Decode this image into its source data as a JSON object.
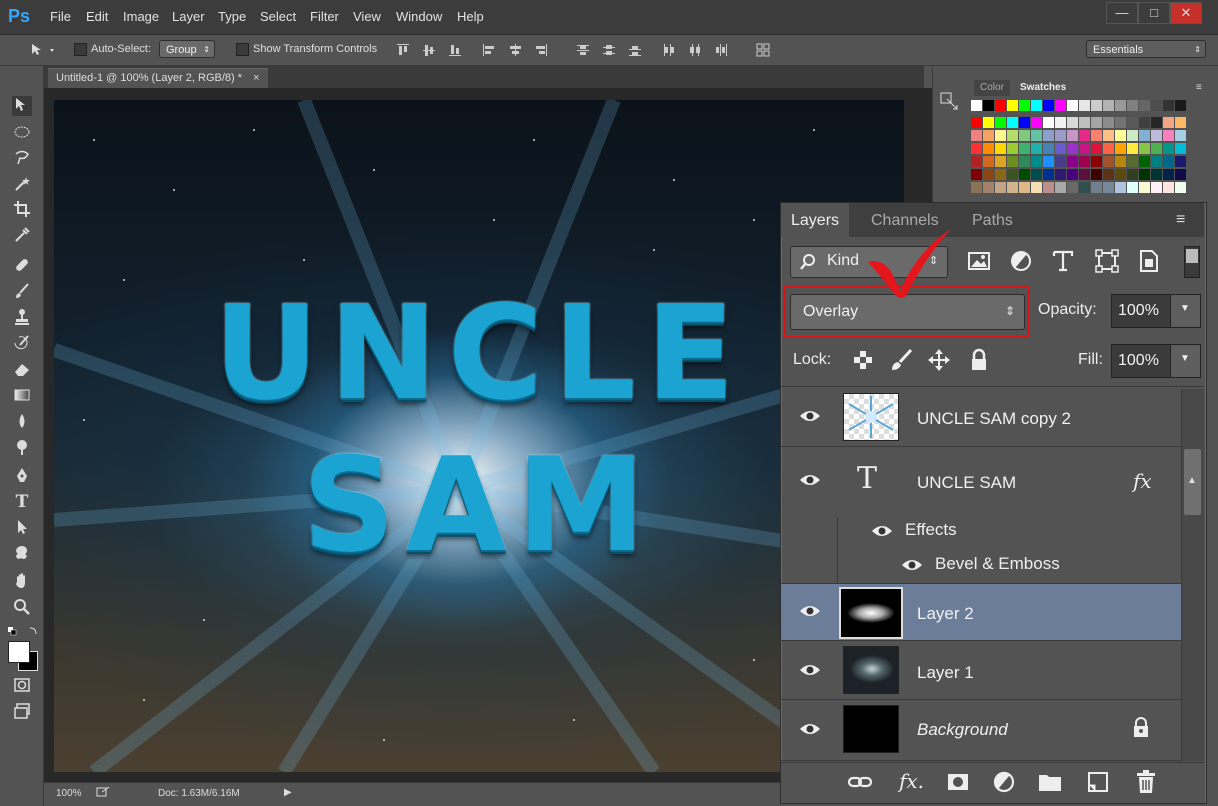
{
  "app": {
    "logo": "Ps",
    "menu": [
      "File",
      "Edit",
      "Image",
      "Layer",
      "Type",
      "Select",
      "Filter",
      "View",
      "Window",
      "Help"
    ]
  },
  "window_buttons": [
    "—",
    "□",
    "✕"
  ],
  "options_bar": {
    "auto_select_label": "Auto-Select:",
    "auto_select_value": "Group",
    "show_transform_label": "Show Transform Controls",
    "workspace": "Essentials"
  },
  "document": {
    "tab_title": "Untitled-1 @ 100% (Layer 2, RGB/8) *",
    "zoom": "100%",
    "doc_size": "Doc: 1.63M/6.16M"
  },
  "artwork": {
    "line1": "UNCLE",
    "line2": "SAM"
  },
  "swatches_panel": {
    "tabs": [
      "Color",
      "Swatches"
    ],
    "active_tab": "Swatches",
    "rows": [
      [
        "#ffffff",
        "#000000",
        "#ff0000",
        "#ffff00",
        "#00ff00",
        "#00ffff",
        "#0000ff",
        "#ff00ff",
        "#ffffff",
        "#e6e6e6",
        "#cccccc",
        "#b3b3b3",
        "#999999",
        "#808080",
        "#666666",
        "#4d4d4d",
        "#333333",
        "#1a1a1a"
      ],
      [
        "#ff0000",
        "#ffff00",
        "#00ff00",
        "#00ffff",
        "#0000ff",
        "#ff00ff",
        "#ffffff",
        "#f2f2f2",
        "#d9d9d9",
        "#bfbfbf",
        "#a6a6a6",
        "#8c8c8c",
        "#737373",
        "#595959",
        "#404040",
        "#262626",
        "#f4a582",
        "#fdb863"
      ],
      [
        "#f08080",
        "#f4a460",
        "#fff68f",
        "#b3de69",
        "#7fc97f",
        "#66c2a5",
        "#8da0cb",
        "#9e9ac8",
        "#c994c7",
        "#e7298a",
        "#fb8072",
        "#fdc086",
        "#ffff99",
        "#ccebc5",
        "#80b1d3",
        "#bebada",
        "#f781bf",
        "#a6cee3"
      ],
      [
        "#ff3030",
        "#ff8c00",
        "#ffd700",
        "#9acd32",
        "#3cb371",
        "#20b2aa",
        "#4682b4",
        "#6a5acd",
        "#9932cc",
        "#c71585",
        "#dc143c",
        "#ff6347",
        "#ffa500",
        "#ffeb3b",
        "#8bc34a",
        "#4caf50",
        "#009688",
        "#00bcd4"
      ],
      [
        "#b22222",
        "#d2691e",
        "#daa520",
        "#6b8e23",
        "#2e8b57",
        "#008b8b",
        "#1e90ff",
        "#483d8b",
        "#8b008b",
        "#a0004f",
        "#8b0000",
        "#a0522d",
        "#b8860b",
        "#556b2f",
        "#006400",
        "#008080",
        "#00688b",
        "#191970"
      ],
      [
        "#7f0000",
        "#8b4513",
        "#8b6914",
        "#3b5323",
        "#004d00",
        "#004d4d",
        "#00308f",
        "#2e1a6e",
        "#4b0082",
        "#5b0f3a",
        "#3f0000",
        "#5c3317",
        "#5c4a0d",
        "#2f3f1f",
        "#003300",
        "#003333",
        "#002447",
        "#120a4a"
      ],
      [
        "#8b7355",
        "#a0826d",
        "#c4a484",
        "#d2b48c",
        "#deb887",
        "#f5deb3",
        "#bc8f8f",
        "#a9a9a9",
        "#696969",
        "#2f4f4f",
        "#708090",
        "#778899",
        "#b0c4de",
        "#e0ffff",
        "#fafad2",
        "#fff0f5",
        "#ffe4e1",
        "#f0fff0"
      ]
    ]
  },
  "layers_panel": {
    "tabs": [
      "Layers",
      "Channels",
      "Paths"
    ],
    "kind_label": "Kind",
    "blend_mode": "Overlay",
    "opacity_label": "Opacity:",
    "opacity_value": "100%",
    "lock_label": "Lock:",
    "fill_label": "Fill:",
    "fill_value": "100%",
    "layers": [
      {
        "name": "UNCLE SAM copy 2"
      },
      {
        "name": "UNCLE SAM",
        "fx": "fx",
        "effects_label": "Effects",
        "effect": "Bevel & Emboss"
      },
      {
        "name": "Layer 2",
        "selected": true
      },
      {
        "name": "Layer 1"
      },
      {
        "name": "Background"
      }
    ]
  },
  "colors": {
    "accent_highlight": "#d4161c",
    "selected_row": "#6b7d99",
    "text_blue": "#1ba3d2"
  }
}
